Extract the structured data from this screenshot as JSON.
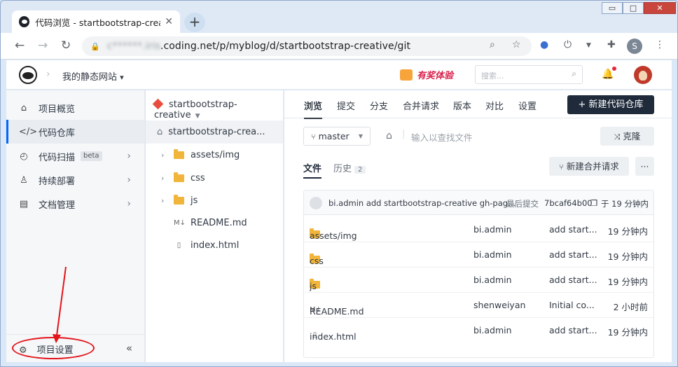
{
  "browser": {
    "tab_title": "代码浏览 - startbootstrap-creat",
    "tab_close": "✕",
    "new_tab": "+",
    "url_host_blurred": "c******.iris",
    "url_rest": ".coding.net/p/myblog/d/startbootstrap-creative/git",
    "profile_initial": "S",
    "controls": {
      "minimize": "▭",
      "maximize": "□",
      "close": "✕"
    }
  },
  "header": {
    "project_name": "我的静态网站",
    "promo_text": "有奖体验",
    "search_placeholder": "搜索...",
    "crumb_sep": "›",
    "project_caret": "▾"
  },
  "sidebar": {
    "items": [
      {
        "label": "项目概览",
        "icon": "home-icon"
      },
      {
        "label": "代码仓库",
        "icon": "code-icon"
      },
      {
        "label": "代码扫描",
        "icon": "scan-icon",
        "badge": "beta"
      },
      {
        "label": "持续部署",
        "icon": "rocket-icon"
      },
      {
        "label": "文档管理",
        "icon": "doc-icon"
      }
    ],
    "settings_label": "项目设置",
    "collapse_glyph": "«"
  },
  "tree": {
    "repo_name": "startbootstrap-creative",
    "root_label": "startbootstrap-crea...",
    "items": [
      {
        "name": "assets/img",
        "type": "folder"
      },
      {
        "name": "css",
        "type": "folder"
      },
      {
        "name": "js",
        "type": "folder"
      },
      {
        "name": "README.md",
        "type": "markdown"
      },
      {
        "name": "index.html",
        "type": "html"
      }
    ]
  },
  "main": {
    "tabs": [
      "浏览",
      "提交",
      "分支",
      "合并请求",
      "版本",
      "对比",
      "设置"
    ],
    "new_repo_button": "+ 新建代码仓库",
    "branch": "master",
    "path_placeholder": "输入以查找文件",
    "clone_button": "克隆",
    "subtabs": {
      "files": "文件",
      "history": "历史",
      "history_count": "2"
    },
    "new_mr_button": "新建合并请求",
    "more_button": "···",
    "last_commit": {
      "text": "bi.admin add startbootstrap-creative gh-pag...",
      "label": "最后提交",
      "hash": "7bcaf64b00",
      "time": "于 19 分钟内"
    },
    "files": [
      {
        "name": "assets/img",
        "type": "folder",
        "author": "bi.admin",
        "message": "add start...",
        "time": "19 分钟内"
      },
      {
        "name": "css",
        "type": "folder",
        "author": "bi.admin",
        "message": "add start...",
        "time": "19 分钟内"
      },
      {
        "name": "js",
        "type": "folder",
        "author": "bi.admin",
        "message": "add start...",
        "time": "19 分钟内"
      },
      {
        "name": "README.md",
        "type": "markdown",
        "author": "shenweiyan",
        "message": "Initial co...",
        "time": "2 小时前"
      },
      {
        "name": "index.html",
        "type": "html",
        "author": "bi.admin",
        "message": "add start...",
        "time": "19 分钟内"
      }
    ]
  },
  "colors": {
    "accent": "#0066ff",
    "annotation_red": "#e3141a",
    "dark_button": "#1f2a3a",
    "folder": "#f2b53b"
  }
}
